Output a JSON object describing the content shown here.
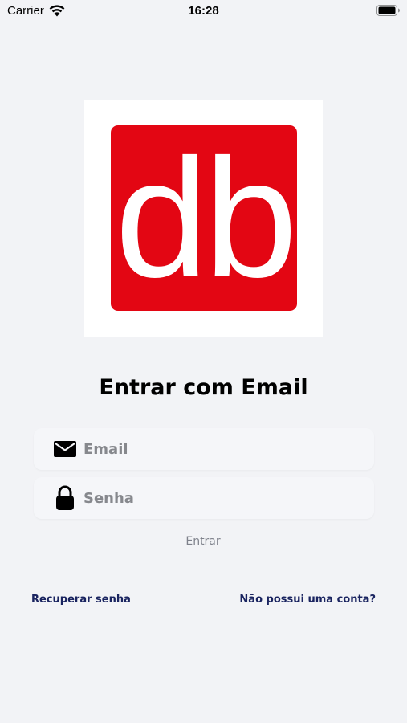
{
  "status_bar": {
    "carrier": "Carrier",
    "time": "16:28"
  },
  "logo": {
    "text": "db",
    "background_color": "#e30613",
    "text_color": "#ffffff"
  },
  "login": {
    "title": "Entrar com Email",
    "email_placeholder": "Email",
    "email_value": "",
    "password_placeholder": "Senha",
    "password_value": "",
    "submit_label": "Entrar",
    "recover_label": "Recuperar senha",
    "signup_label": "Não possui uma conta?"
  },
  "icons": {
    "email": "envelope-icon",
    "password": "lock-icon",
    "wifi": "wifi-icon",
    "battery": "battery-icon"
  },
  "colors": {
    "background": "#f2f3f6",
    "link": "#1a2460",
    "muted_button": "#7e818b"
  }
}
